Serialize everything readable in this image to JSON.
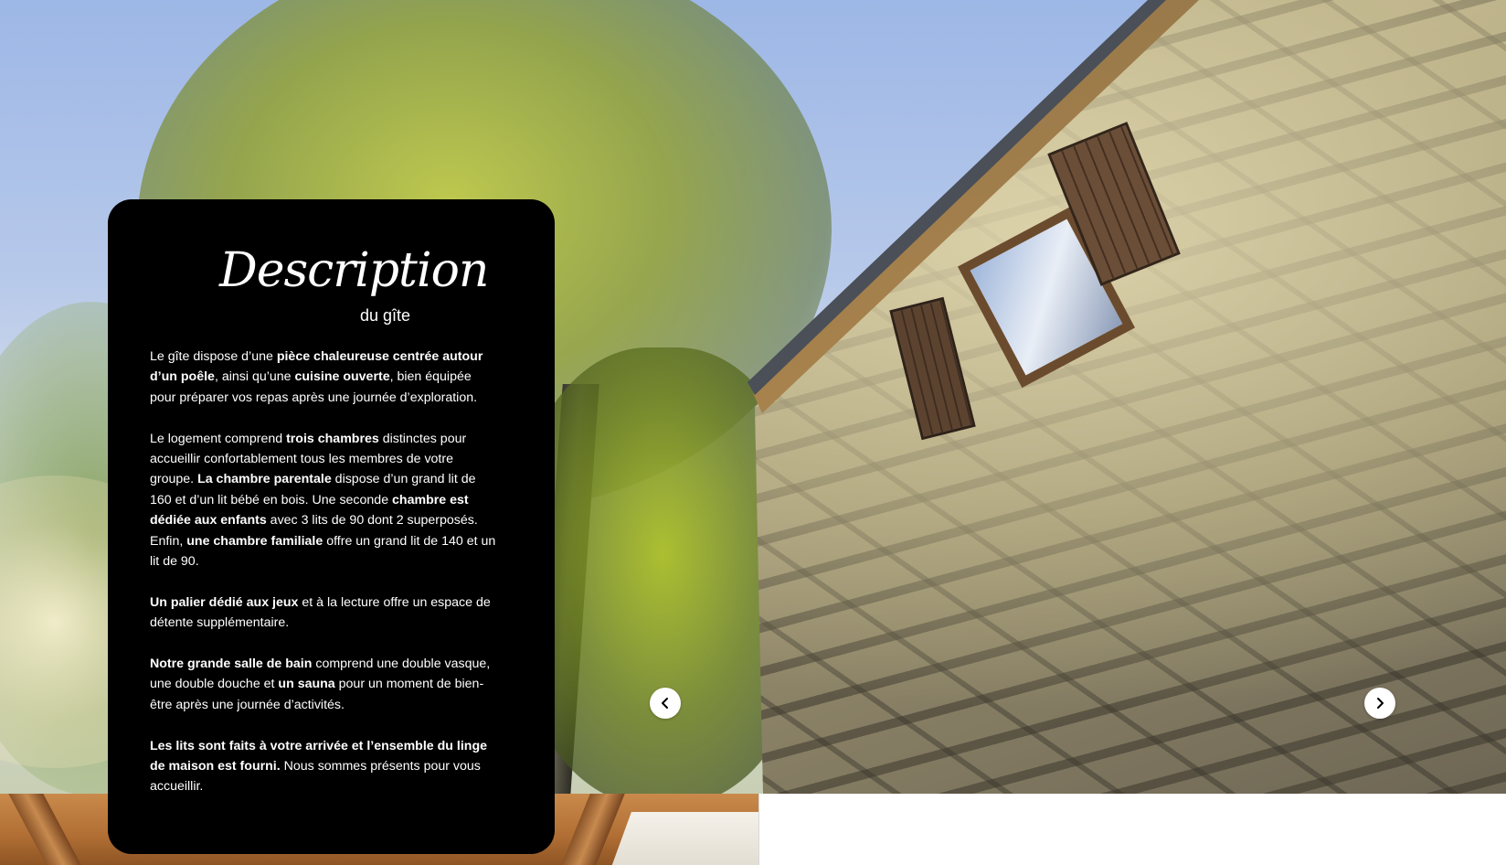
{
  "description": {
    "title": "Description",
    "subtitle": "du gîte",
    "paragraphs": [
      [
        {
          "text": "Le gîte dispose d’une ",
          "bold": false
        },
        {
          "text": "pièce chaleureuse centrée autour d’un poêle",
          "bold": true
        },
        {
          "text": ", ainsi qu’une ",
          "bold": false
        },
        {
          "text": "cuisine ouverte",
          "bold": true
        },
        {
          "text": ", bien équipée pour préparer vos repas après une journée d’exploration.",
          "bold": false
        }
      ],
      [
        {
          "text": "Le logement comprend ",
          "bold": false
        },
        {
          "text": "trois chambres",
          "bold": true
        },
        {
          "text": " distinctes pour accueillir confortablement tous les membres de votre groupe. ",
          "bold": false
        },
        {
          "text": "La chambre parentale",
          "bold": true
        },
        {
          "text": " dispose d’un grand lit de 160 et d’un lit bébé en bois. Une seconde ",
          "bold": false
        },
        {
          "text": "chambre est dédiée aux enfants",
          "bold": true
        },
        {
          "text": " avec 3 lits de 90 dont 2 superposés. Enfin, ",
          "bold": false
        },
        {
          "text": "une chambre familiale",
          "bold": true
        },
        {
          "text": " offre un grand lit de 140 et un lit de 90.",
          "bold": false
        }
      ],
      [
        {
          "text": "Un palier dédié aux jeux",
          "bold": true
        },
        {
          "text": " et à la lecture offre un espace de détente supplémentaire.",
          "bold": false
        }
      ],
      [
        {
          "text": "Notre grande salle de bain",
          "bold": true
        },
        {
          "text": " comprend une double vasque, une double douche et ",
          "bold": false
        },
        {
          "text": "un sauna",
          "bold": true
        },
        {
          "text": " pour un moment de bien-être après une journée d’activités.",
          "bold": false
        }
      ],
      [
        {
          "text": "Les lits sont faits à votre arrivée et l’ensemble du linge de maison est fourni.",
          "bold": true
        },
        {
          "text": " Nous sommes présents pour vous accueillir.",
          "bold": false
        }
      ]
    ]
  },
  "carousel": {
    "prev_icon": "chevron-left-icon",
    "next_icon": "chevron-right-icon"
  },
  "colors": {
    "card_background": "#000000",
    "card_text": "#ffffff",
    "arrow_background": "#ffffff"
  }
}
